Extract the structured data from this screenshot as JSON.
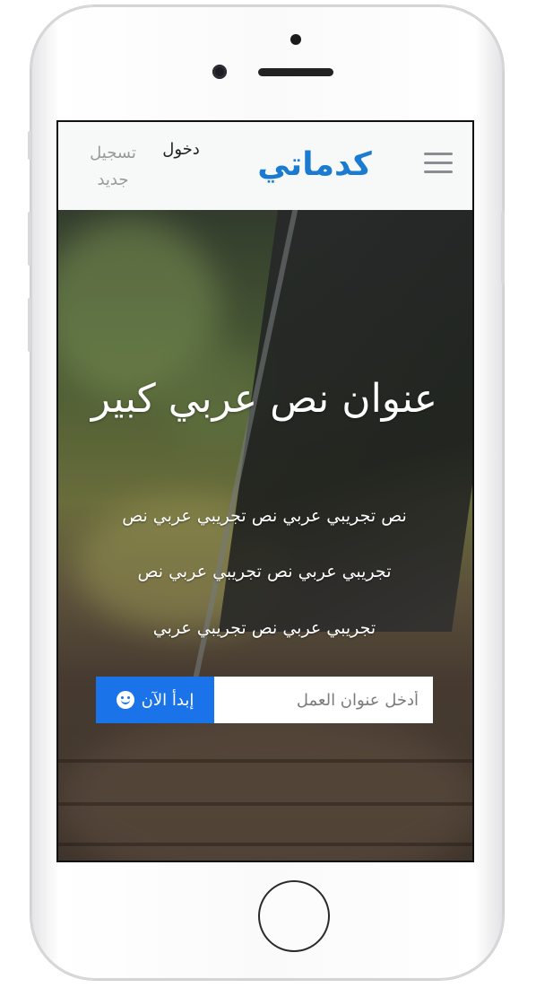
{
  "header": {
    "logo_text": "كدماتي",
    "login_label": "دخول",
    "register_label": "تسجيل جديد",
    "menu_icon": "hamburger-menu-icon"
  },
  "hero": {
    "title": "عنوان نص عربي كبير",
    "line_1": "نص تجريبي عربي نص تجريبي عربي نص",
    "line_2": "تجريبي عربي نص تجريبي عربي نص",
    "line_3": "تجريبي عربي نص تجريبي عربي",
    "search_placeholder": "أدخل عنوان العمل",
    "start_label": "إبدأ الآن",
    "start_icon": "smile-icon"
  },
  "colors": {
    "accent": "#1a73e8",
    "logo": "#1a7bd1"
  }
}
